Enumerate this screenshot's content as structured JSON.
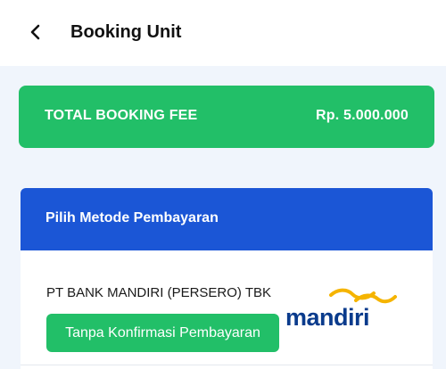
{
  "header": {
    "back_icon": "chevron-left-icon",
    "title": "Booking Unit"
  },
  "fee": {
    "label": "TOTAL BOOKING FEE",
    "value": "Rp. 5.000.000",
    "color": "#22bf68"
  },
  "payment": {
    "title": "Pilih Metode Pembayaran",
    "header_color": "#1b56d6",
    "bank_name": "PT BANK MANDIRI (PERSERO) TBK",
    "button_label": "Tanpa Konfirmasi Pembayaran",
    "logo_text": "mandiri",
    "logo_text_color": "#0a3b8c",
    "logo_wave_color": "#f5b400"
  }
}
